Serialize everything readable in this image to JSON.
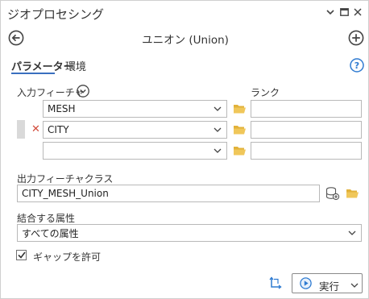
{
  "window": {
    "title": "ジオプロセシング"
  },
  "tool": {
    "name": "ユニオン (Union)"
  },
  "tabs": [
    {
      "label": "パラメーター",
      "active": true
    },
    {
      "label": "環境",
      "active": false
    }
  ],
  "input_features": {
    "label": "入力フィーチャ",
    "rank_label": "ランク",
    "rows": [
      {
        "feature": "MESH",
        "rank": ""
      },
      {
        "feature": "CITY",
        "rank": ""
      },
      {
        "feature": "",
        "rank": ""
      }
    ]
  },
  "output": {
    "label": "出力フィーチャクラス",
    "value": "CITY_MESH_Union"
  },
  "join_attributes": {
    "label": "結合する属性",
    "value": "すべての属性"
  },
  "gaps": {
    "label": "ギャップを許可",
    "checked": true
  },
  "run": {
    "label": "実行"
  },
  "colors": {
    "accent": "#3a6fbf",
    "folder": "#e2b23a",
    "remove": "#d24a3a",
    "run_icon": "#2f7bd1"
  }
}
